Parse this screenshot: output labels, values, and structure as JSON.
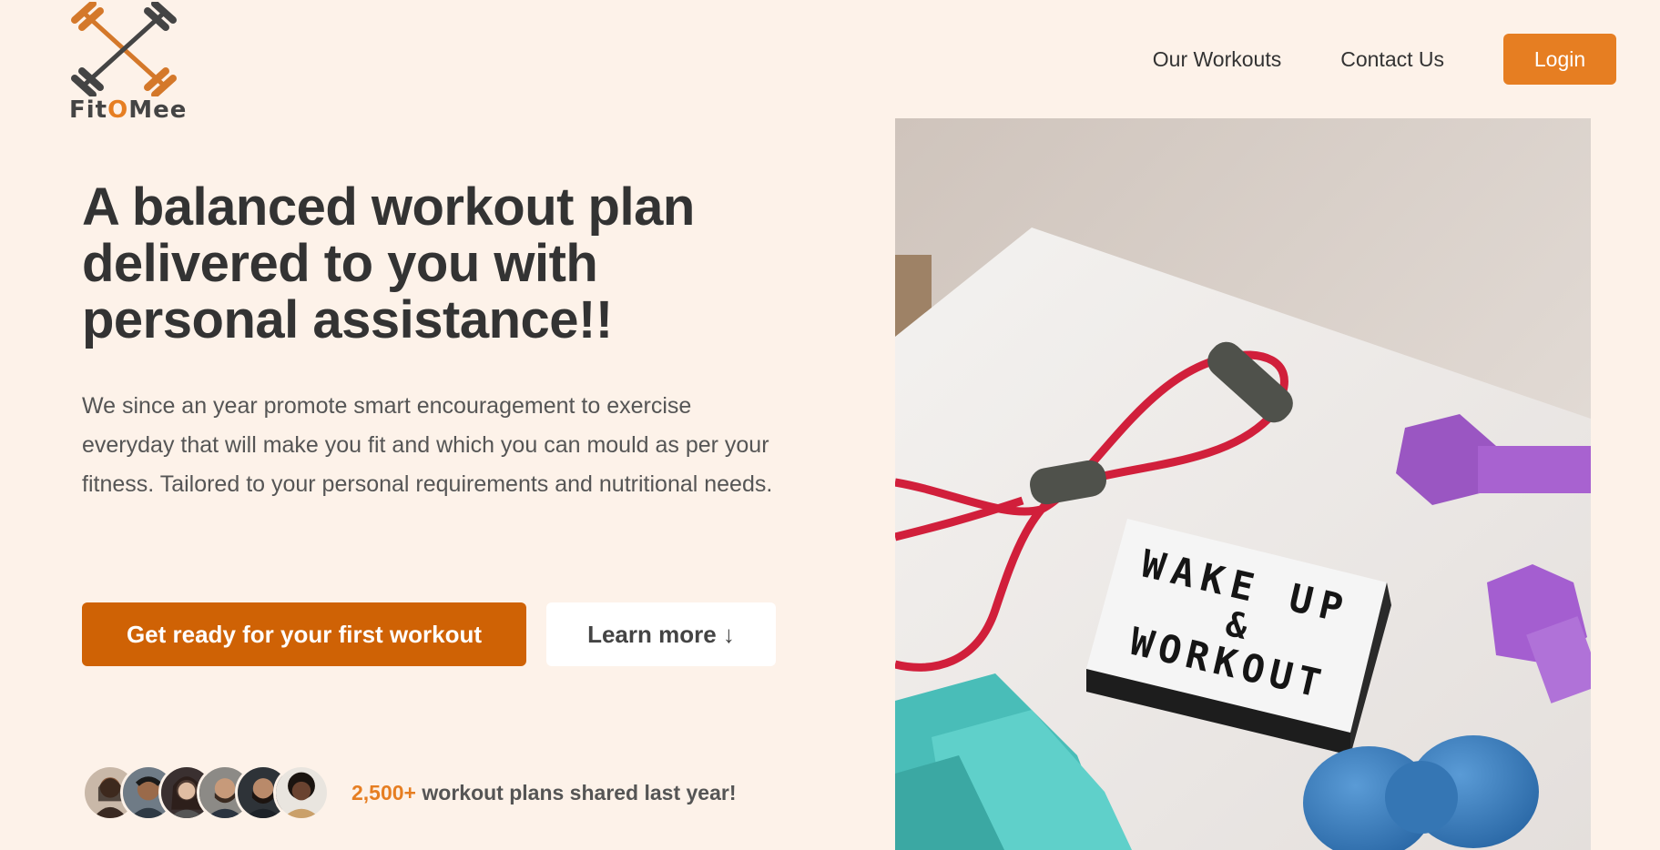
{
  "brand": {
    "name_prefix": "Fit",
    "name_o": "O",
    "name_suffix": "Mee",
    "icon": "crossed-dumbbells-icon",
    "accent_color": "#e67e22"
  },
  "nav": {
    "links": [
      "Our Workouts",
      "Contact Us"
    ],
    "login_label": "Login"
  },
  "hero": {
    "title": "A balanced workout plan delivered to you with personal assistance!!",
    "description": "We since an year promote smart encouragement to exercise everyday that will make you fit and which you can mould as per your fitness. Tailored to your personal requirements and nutritional needs.",
    "primary_cta": "Get ready for your first workout",
    "secondary_cta": "Learn more ↓",
    "primary_color": "#cf6205"
  },
  "social_proof": {
    "count": "2,500+",
    "text": "workout plans shared last year!",
    "avatar_count": 6
  },
  "image": {
    "lightbox_line1": "WAKE UP",
    "lightbox_line2": "&",
    "lightbox_line3": "WORKOUT"
  }
}
